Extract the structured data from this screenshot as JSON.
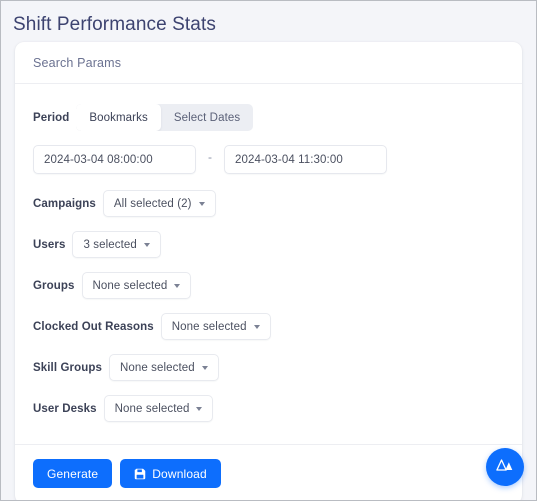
{
  "header": {
    "title": "Shift Performance Stats"
  },
  "card": {
    "section_title": "Search Params",
    "period": {
      "label": "Period",
      "tabs": [
        {
          "label": "Bookmarks",
          "active": true
        },
        {
          "label": "Select Dates",
          "active": false
        }
      ],
      "date_from": "2024-03-04 08:00:00",
      "date_to": "2024-03-04 11:30:00",
      "date_separator": "-"
    },
    "filters": [
      {
        "label": "Campaigns",
        "value": "All selected (2)"
      },
      {
        "label": "Users",
        "value": "3 selected"
      },
      {
        "label": "Groups",
        "value": "None selected"
      },
      {
        "label": "Clocked Out Reasons",
        "value": "None selected"
      },
      {
        "label": "Skill Groups",
        "value": "None selected"
      },
      {
        "label": "User Desks",
        "value": "None selected"
      }
    ],
    "footer": {
      "generate_label": "Generate",
      "download_label": "Download",
      "download_icon": "save-disk-icon"
    }
  },
  "fab": {
    "icon": "brand-logo-icon"
  },
  "colors": {
    "accent": "#0d6efd",
    "page_background": "#f4f5f9",
    "card_background": "#ffffff",
    "title_text": "#3d4370",
    "label_text": "#3c4257",
    "muted_text": "#6b7291",
    "border": "#e8eaef"
  }
}
